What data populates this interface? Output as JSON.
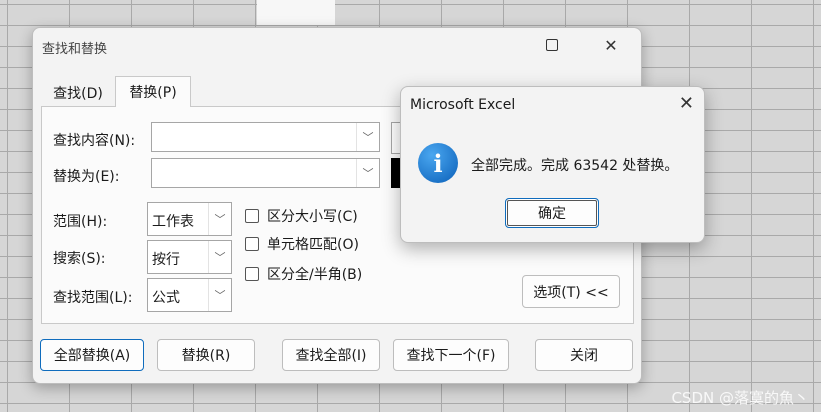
{
  "dialog": {
    "title": "查找和替换",
    "tabs": {
      "find": "查找(D)",
      "replace": "替换(P)"
    },
    "find_what_label": "查找内容(N):",
    "find_what_value": "",
    "replace_with_label": "替换为(E):",
    "replace_with_value": "",
    "within_label": "范围(H):",
    "within_value": "工作表",
    "search_label": "搜索(S):",
    "search_value": "按行",
    "look_in_label": "查找范围(L):",
    "look_in_value": "公式",
    "match_case": "区分大小写(C)",
    "match_entire": "单元格匹配(O)",
    "match_width": "区分全/半角(B)",
    "options_button": "选项(T) <<",
    "buttons": {
      "replace_all": "全部替换(A)",
      "replace": "替换(R)",
      "find_all": "查找全部(I)",
      "find_next": "查找下一个(F)",
      "close": "关闭"
    }
  },
  "message_box": {
    "title": "Microsoft Excel",
    "text": "全部完成。完成 63542 处替换。",
    "ok": "确定",
    "icon": "info-icon"
  },
  "watermark": "CSDN @落寞的魚丶"
}
